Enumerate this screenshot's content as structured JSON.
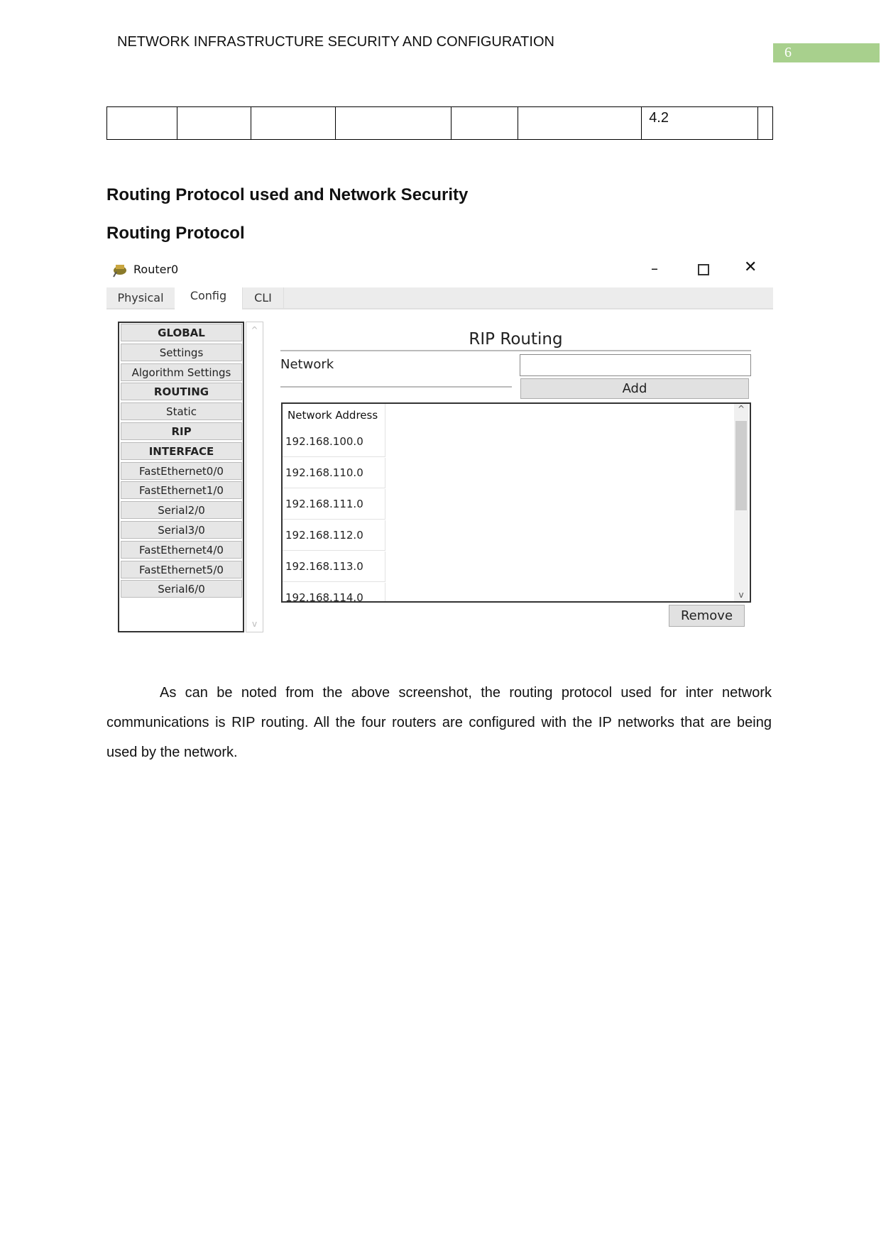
{
  "header": {
    "title": "NETWORK INFRASTRUCTURE SECURITY AND CONFIGURATION",
    "page_number": "6",
    "page_badge_color": "#a8d08d"
  },
  "table": {
    "cells": [
      "",
      "",
      "",
      "",
      "",
      "",
      "4.2",
      ""
    ]
  },
  "headings": {
    "h1": "Routing Protocol used and Network Security",
    "h2": "Routing Protocol"
  },
  "window": {
    "title": "Router0",
    "tabs": [
      "Physical",
      "Config",
      "CLI"
    ],
    "active_tab": "Config",
    "sidebar": [
      "GLOBAL",
      "Settings",
      "Algorithm Settings",
      "ROUTING",
      "Static",
      "RIP",
      "INTERFACE",
      "FastEthernet0/0",
      "FastEthernet1/0",
      "Serial2/0",
      "Serial3/0",
      "FastEthernet4/0",
      "FastEthernet5/0",
      "Serial6/0"
    ],
    "panel": {
      "title": "RIP Routing",
      "network_label": "Network",
      "network_value": "",
      "add_label": "Add",
      "column_header": "Network Address",
      "networks": [
        "192.168.100.0",
        "192.168.110.0",
        "192.168.111.0",
        "192.168.112.0",
        "192.168.113.0",
        "192.168.114.0"
      ],
      "remove_label": "Remove"
    }
  },
  "paragraph": "As can be noted from the above screenshot, the routing protocol used for inter network communications is RIP routing. All the four routers are configured with the IP networks that are being used by the network."
}
